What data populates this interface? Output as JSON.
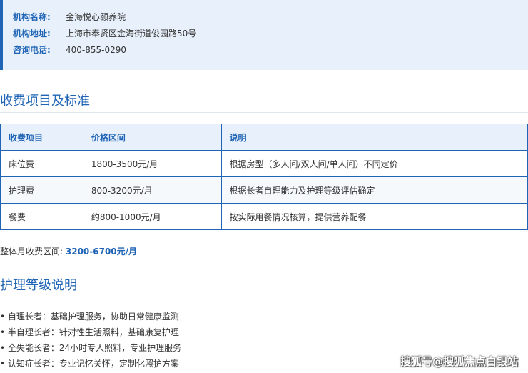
{
  "institution": {
    "name_label": "机构名称:",
    "name_value": "金海悦心颐养院",
    "address_label": "机构地址:",
    "address_value": "上海市奉贤区金海街道俊园路50号",
    "phone_label": "咨询电话:",
    "phone_value": "400-855-0290"
  },
  "fees_section": {
    "title": "收费项目及标准",
    "headers": [
      "收费项目",
      "价格区间",
      "说明"
    ],
    "rows": [
      [
        "床位费",
        "1800-3500元/月",
        "根据房型（多人间/双人间/单人间）不同定价"
      ],
      [
        "护理费",
        "800-3200元/月",
        "根据长者自理能力及护理等级评估确定"
      ],
      [
        "餐费",
        "约800-1000元/月",
        "按实际用餐情况核算，提供营养配餐"
      ]
    ],
    "total_label": "整体月收费区间:",
    "total_value": "3200-6700元/月"
  },
  "care_section": {
    "title": "护理等级说明",
    "items": [
      "• 自理长者：基础护理服务，协助日常健康监测",
      "• 半自理长者：针对性生活照料，基础康复护理",
      "• 全失能长者：24小时专人照料，专业护理服务",
      "• 认知症长者：专业记忆关怀，定制化照护方案"
    ]
  },
  "watermark": "搜狐号@搜狐焦点白银站",
  "colors": {
    "accent": "#1f64b5",
    "info_bg": "#e8f1fb"
  }
}
